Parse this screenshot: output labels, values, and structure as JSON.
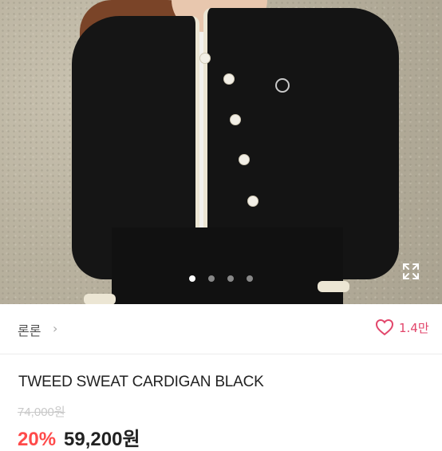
{
  "carousel": {
    "image_desc_icon": "product-photo",
    "dot_count": 4,
    "active_dot": 0,
    "expand_icon": "expand-icon"
  },
  "seller": {
    "name": "론론",
    "chevron": "›"
  },
  "likes": {
    "icon": "heart-outline-icon",
    "count": "1.4만",
    "color": "#e2466b"
  },
  "product": {
    "title": "TWEED SWEAT CARDIGAN BLACK",
    "original_price": "74,000원",
    "discount": "20%",
    "price": "59,200원",
    "discount_color": "#ff4a4a"
  }
}
